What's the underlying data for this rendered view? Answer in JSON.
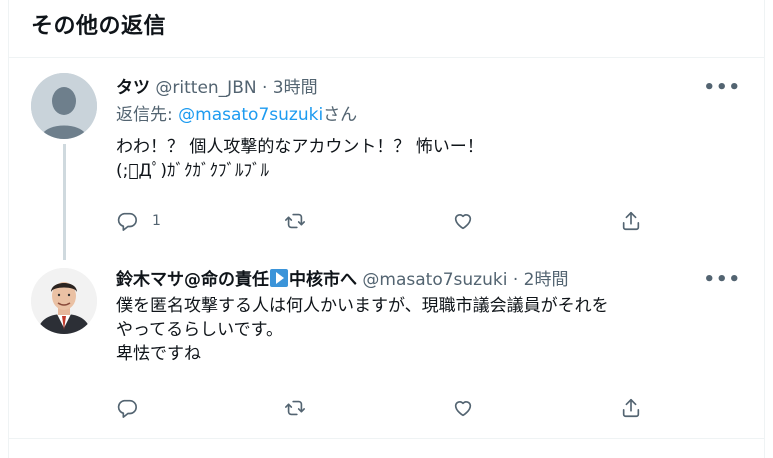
{
  "section": {
    "title": "その他の返信"
  },
  "tweets": [
    {
      "display_name": "タツ",
      "handle": "@ritten_JBN",
      "separator": "·",
      "time": "3時間",
      "reply_prefix": "返信先: ",
      "reply_mention": "@masato7suzuki",
      "reply_suffix": "さん",
      "body": [
        "わわ！？ 個人攻撃的なアカウント！？ 怖いー！",
        "(;ﾟДﾟ)ｶﾞｸｶﾞｸﾌﾞﾙﾌﾞﾙ"
      ],
      "more": "•••",
      "reply_count": "1",
      "retweet_count": "",
      "like_count": ""
    },
    {
      "display_name_a": "鈴木マサ@命の責任",
      "display_name_b": "中核市へ",
      "handle": "@masato7suzuki",
      "separator": "·",
      "time": "2時間",
      "body": [
        "僕を匿名攻撃する人は何人かいますが、現職市議会議員がそれを",
        "やってるらしいです。",
        "卑怯ですね"
      ],
      "more": "•••",
      "reply_count": "",
      "retweet_count": "",
      "like_count": ""
    }
  ],
  "icons": {
    "reply": "reply-icon",
    "retweet": "retweet-icon",
    "like": "heart-icon",
    "share": "share-icon",
    "more": "more-icon",
    "flag": "play-arrow-emoji-icon"
  },
  "colors": {
    "accent": "#1d9bf0",
    "secondary_text": "#536471",
    "primary_text": "#0f1419",
    "divider": "#eff3f4"
  }
}
